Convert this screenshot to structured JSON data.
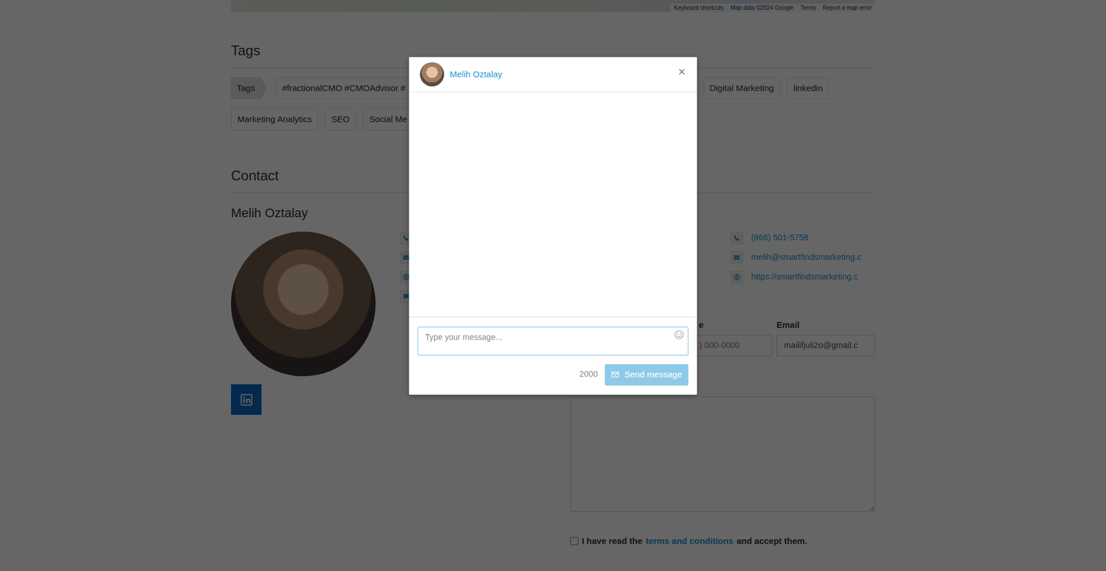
{
  "map": {
    "attribution": [
      "Keyboard shortcuts",
      "Map data ©2024 Google",
      "Terms",
      "Report a map error"
    ]
  },
  "tags": {
    "heading": "Tags",
    "label": "Tags",
    "items": [
      "#fractionalCMO #CMOAdvisor #",
      "Digital Marketing",
      "linkedin",
      "Marketing Analytics",
      "SEO",
      "Social Me"
    ]
  },
  "contact": {
    "heading": "Contact",
    "name": "Melih Oztalay",
    "details": [
      {
        "kind": "phone",
        "text": "(866) 501-5758"
      },
      {
        "kind": "email",
        "text": "melih@smartfindsmarketing.c"
      },
      {
        "kind": "web",
        "text": "https://smartfindsmarketing.c"
      }
    ]
  },
  "form": {
    "phone": {
      "label": "e",
      "placeholder": ") 000-0000"
    },
    "email": {
      "label": "Email",
      "value": "mailifjuli2o@gmail.c"
    },
    "terms": {
      "checked": false,
      "before": "I have read the",
      "link": "terms and conditions",
      "after": "and accept them."
    }
  },
  "modal": {
    "name": "Melih Oztalay",
    "close": "×",
    "placeholder": "Type your message...",
    "counter": "2000",
    "send": {
      "label": "Send message",
      "disabled": true
    }
  }
}
